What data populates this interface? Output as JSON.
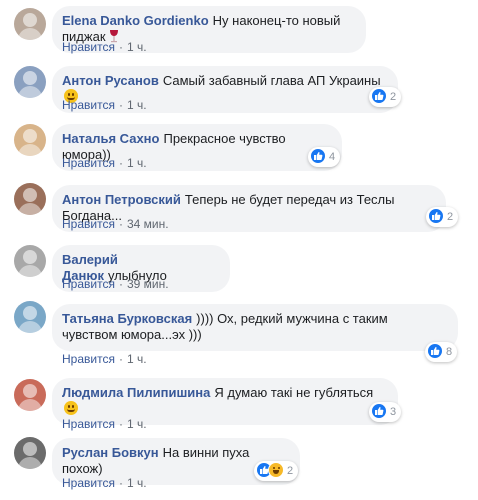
{
  "colors": {
    "author": "#385898",
    "bubble": "#f2f3f5",
    "meta": "#606770",
    "like": "#1877f2"
  },
  "comments": [
    {
      "author": "Elena Danko Gordienko",
      "text": "Ну наконец-то новый пиджак",
      "like_label": "Нравится",
      "time": "1 ч.",
      "emoji": "wine-glass-icon",
      "reactions": null,
      "avatar_color": "#b9a89a"
    },
    {
      "author": "Антон Русанов",
      "text": "Самый забавный глава АП Украины",
      "like_label": "Нравится",
      "time": "1 ч.",
      "emoji": "smile-icon",
      "reactions": {
        "icons": [
          "like"
        ],
        "count": "2"
      },
      "avatar_color": "#8aa0c0"
    },
    {
      "author": "Наталья Сахно",
      "text": "Прекрасное чувство юмора))",
      "like_label": "Нравится",
      "time": "1 ч.",
      "reactions": {
        "icons": [
          "like"
        ],
        "count": "4"
      },
      "avatar_color": "#d8b48a"
    },
    {
      "author": "Антон Петровский",
      "text": "Теперь не будет передач из Теслы Богдана...",
      "like_label": "Нравится",
      "time": "34 мин.",
      "reactions": {
        "icons": [
          "like"
        ],
        "count": "2"
      },
      "avatar_color": "#9a6f5a"
    },
    {
      "author": "Валерий Данюк",
      "text": "улыбнуло",
      "like_label": "Нравится",
      "time": "39 мин.",
      "reactions": null,
      "avatar_color": "#a8a8a8"
    },
    {
      "author": "Татьяна Бурковская",
      "text": ")))) Ох, редкий мужчина с таким чувством юмора...эх )))",
      "like_label": "Нравится",
      "time": "1 ч.",
      "reactions": {
        "icons": [
          "like"
        ],
        "count": "8"
      },
      "avatar_color": "#7aa7c7"
    },
    {
      "author": "Людмила Пилипишина",
      "text": "Я думаю такі не губляться",
      "like_label": "Нравится",
      "time": "1 ч.",
      "emoji": "smile-icon",
      "reactions": {
        "icons": [
          "like"
        ],
        "count": "3"
      },
      "avatar_color": "#c96b5a"
    },
    {
      "author": "Руслан Бовкун",
      "text": "На винни пуха похож)",
      "like_label": "Нравится",
      "time": "1 ч.",
      "reactions": {
        "icons": [
          "like",
          "haha"
        ],
        "count": "2"
      },
      "avatar_color": "#6b6b6b"
    }
  ]
}
